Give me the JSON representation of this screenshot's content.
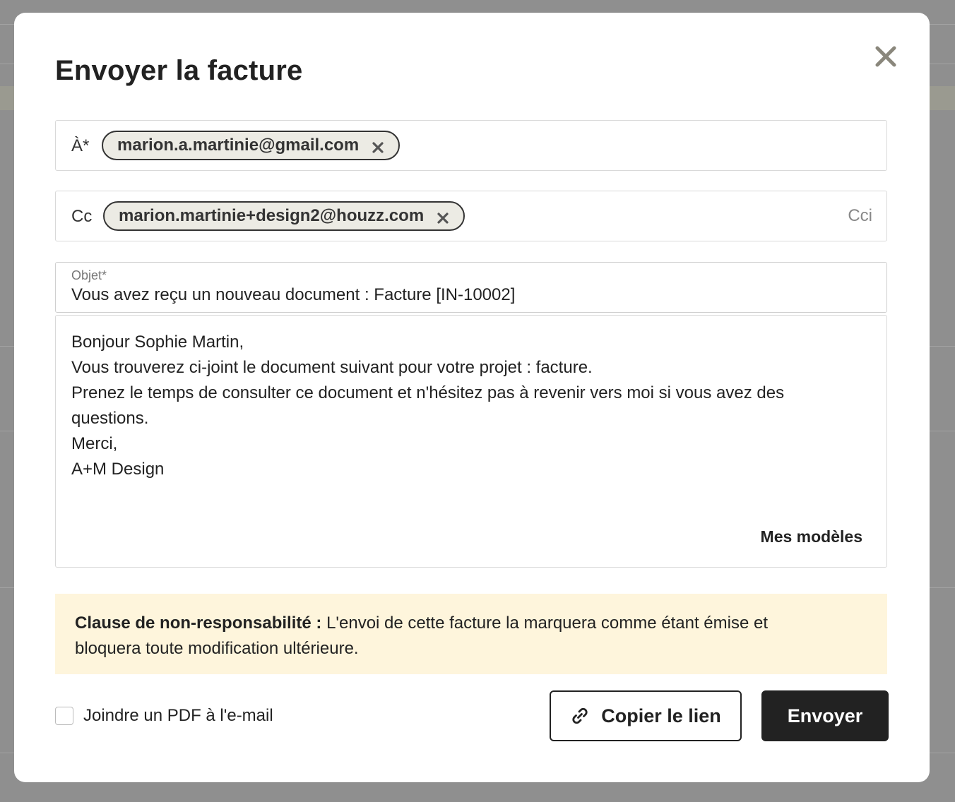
{
  "dialog": {
    "title": "Envoyer la facture"
  },
  "to": {
    "label": "À*",
    "recipients": [
      "marion.a.martinie@gmail.com"
    ]
  },
  "cc": {
    "label": "Cc",
    "recipients": [
      "marion.martinie+design2@houzz.com"
    ],
    "bcc_label": "Cci"
  },
  "subject": {
    "label": "Objet*",
    "value": "Vous avez reçu un nouveau document : Facture [IN-10002]"
  },
  "body": {
    "lines": [
      "Bonjour Sophie Martin,",
      "Vous trouverez ci-joint le document suivant pour votre projet : facture.",
      "Prenez le temps de consulter ce document et n'hésitez pas à revenir vers moi si vous avez des",
      "questions.",
      "Merci,",
      "A+M Design"
    ],
    "templates_label": "Mes modèles"
  },
  "disclaimer": {
    "title": "Clause de non-responsabilité :",
    "text": "L'envoi de cette facture la marquera comme étant émise et",
    "text2": "bloquera toute modification ultérieure."
  },
  "attach_pdf": {
    "label": "Joindre un PDF à l'e-mail",
    "checked": false
  },
  "actions": {
    "copy_link_label": "Copier le lien",
    "send_label": "Envoyer"
  },
  "colors": {
    "chip_bg": "#ecebe4",
    "disclaimer_bg": "#fef5dc",
    "primary_button": "#222222",
    "close_icon": "#8a877c"
  }
}
